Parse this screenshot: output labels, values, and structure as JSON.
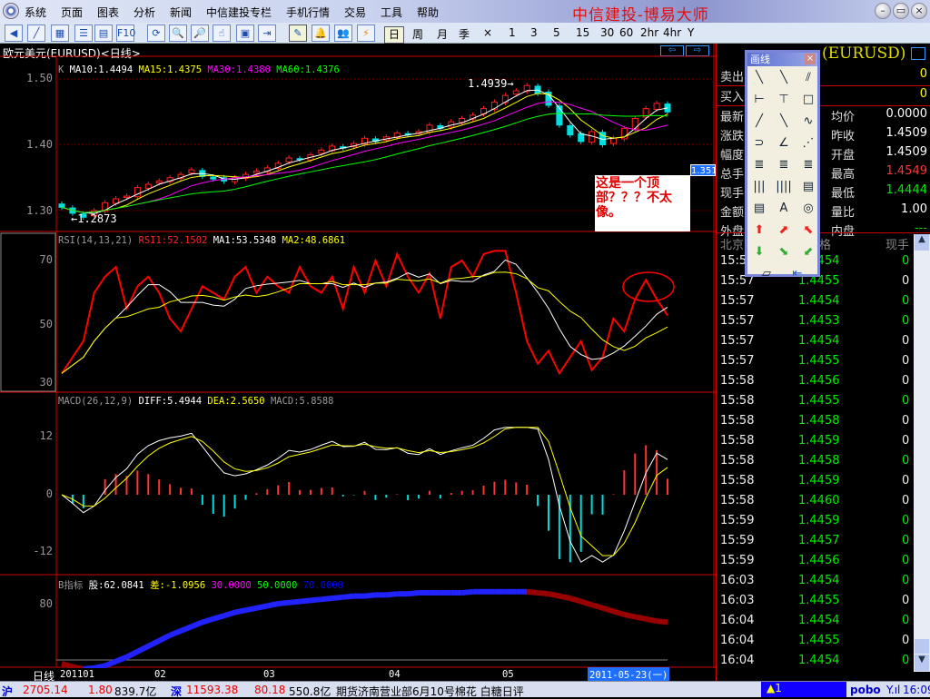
{
  "app": {
    "title": "中信建投-博易大师",
    "window_buttons": [
      "–",
      "▭",
      "×"
    ]
  },
  "menu": [
    "系统",
    "页面",
    "图表",
    "分析",
    "新闻",
    "中信建投专栏",
    "手机行情",
    "交易",
    "工具",
    "帮助"
  ],
  "toolbar": {
    "icons": [
      "back-icon",
      "line-chart-icon",
      "multi-chart-icon",
      "grid-icon",
      "report-icon",
      "f10-icon",
      "refresh-icon",
      "zoom-in-icon",
      "zoom-out-icon",
      "pointer-icon",
      "window-icon",
      "export-icon",
      "draw-icon",
      "alarm-icon",
      "users-icon",
      "flash-icon"
    ],
    "f10_label": "F10",
    "periods": [
      "日",
      "周",
      "月",
      "季",
      "×",
      "1",
      "3",
      "5",
      "15",
      "30",
      "60",
      "2hr",
      "4hr",
      "Y"
    ],
    "active_period": "日"
  },
  "chart": {
    "title": "欧元美元(EURUSD)<日线>",
    "main_header": {
      "k": "K",
      "ma10": "MA10:1.4494",
      "ma15": "MA15:1.4375",
      "ma30": "MA30:1.4380",
      "ma60": "MA60:1.4376"
    },
    "price_ticks": [
      "1.50",
      "1.40",
      "1.30"
    ],
    "high_label": "1.4939→",
    "low_label": "←1.2873",
    "cursor_price": "1.3510",
    "annotation": "这是一个顶部？？？不太像。",
    "rsi_header": {
      "name": "RSI(14,13,21)",
      "rsi1": "RSI1:52.1502",
      "ma1": "MA1:53.5348",
      "ma2": "MA2:48.6861"
    },
    "rsi_ticks": [
      "70",
      "50",
      "30"
    ],
    "macd_header": {
      "name": "MACD(26,12,9)",
      "diff": "DIFF:5.4944",
      "dea": "DEA:2.5650",
      "macd": "MACD:5.8588"
    },
    "macd_ticks": [
      "12",
      "0",
      "-12"
    ],
    "b_header": {
      "name": "B指标",
      "gu": "股:62.0841",
      "cha": "差:-1.0956",
      "l30": "30.0000",
      "l50": "50.0000",
      "l70": "70.0000"
    },
    "b_ticks": [
      "80"
    ],
    "period_label": "日线",
    "dates": [
      "201101",
      "02",
      "03",
      "04",
      "05"
    ],
    "cursor_date": "2011-05-23(一)"
  },
  "chart_data": {
    "type": "candlestick",
    "closes": [
      1.305,
      1.296,
      1.29,
      1.3,
      1.312,
      1.318,
      1.322,
      1.335,
      1.34,
      1.345,
      1.35,
      1.355,
      1.362,
      1.352,
      1.348,
      1.345,
      1.35,
      1.355,
      1.36,
      1.365,
      1.372,
      1.38,
      1.378,
      1.385,
      1.392,
      1.398,
      1.395,
      1.402,
      1.41,
      1.405,
      1.412,
      1.418,
      1.415,
      1.42,
      1.43,
      1.425,
      1.435,
      1.44,
      1.445,
      1.455,
      1.465,
      1.475,
      1.482,
      1.49,
      1.478,
      1.46,
      1.43,
      1.415,
      1.405,
      1.42,
      1.4,
      1.41,
      1.425,
      1.44,
      1.455,
      1.463,
      1.45
    ],
    "rsi": [
      35,
      40,
      45,
      60,
      65,
      68,
      55,
      62,
      65,
      60,
      52,
      48,
      55,
      62,
      60,
      58,
      65,
      68,
      60,
      65,
      62,
      60,
      68,
      62,
      60,
      65,
      55,
      68,
      60,
      70,
      62,
      72,
      65,
      60,
      66,
      52,
      68,
      70,
      65,
      72,
      73,
      73,
      60,
      45,
      38,
      42,
      35,
      40,
      45,
      36,
      40,
      52,
      48,
      58,
      64,
      58,
      53
    ],
    "b_values": [
      25,
      22,
      20,
      21,
      23,
      27,
      31,
      36,
      41,
      46,
      51,
      55,
      59,
      63,
      66,
      69,
      72,
      74,
      76,
      78,
      80,
      81,
      82,
      83,
      84,
      85,
      86,
      87,
      87,
      88,
      88,
      89,
      89,
      90,
      90,
      90,
      90,
      90,
      91,
      91,
      91,
      91,
      91,
      91,
      90,
      89,
      87,
      85,
      82,
      79,
      76,
      73,
      70,
      68,
      66,
      64,
      63
    ],
    "price_range": [
      1.28,
      1.51
    ],
    "rsi_range": [
      30,
      70
    ],
    "macd_range": [
      -12,
      12
    ]
  },
  "quote": {
    "symbol": "(EURUSD)",
    "rows": [
      {
        "label": "卖出",
        "value": "0"
      },
      {
        "label": "买入",
        "value": "0"
      }
    ],
    "left_labels": [
      "最新",
      "涨跌",
      "幅度",
      "总手",
      "现手",
      "金额",
      "外盘"
    ],
    "right": [
      {
        "label": "均价",
        "value": "0.0000"
      },
      {
        "label": "昨收",
        "value": "1.4509"
      },
      {
        "label": "开盘",
        "value": "1.4509"
      },
      {
        "label": "最高",
        "value": "1.4549"
      },
      {
        "label": "最低",
        "value": "1.4444"
      },
      {
        "label": "量比",
        "value": "1.00"
      },
      {
        "label": "内盘",
        "value": "---"
      }
    ],
    "tick_headers": [
      "北京",
      "价格",
      "现手"
    ],
    "ticks": [
      [
        "15:57",
        "1.4454",
        "0",
        "g"
      ],
      [
        "15:57",
        "1.4455",
        "0",
        "w"
      ],
      [
        "15:57",
        "1.4454",
        "0",
        "g"
      ],
      [
        "15:57",
        "1.4453",
        "0",
        "g"
      ],
      [
        "15:57",
        "1.4454",
        "0",
        "w"
      ],
      [
        "15:57",
        "1.4455",
        "0",
        "w"
      ],
      [
        "15:58",
        "1.4456",
        "0",
        "w"
      ],
      [
        "15:58",
        "1.4455",
        "0",
        "g"
      ],
      [
        "15:58",
        "1.4458",
        "0",
        "w"
      ],
      [
        "15:58",
        "1.4459",
        "0",
        "w"
      ],
      [
        "15:58",
        "1.4458",
        "0",
        "g"
      ],
      [
        "15:58",
        "1.4459",
        "0",
        "w"
      ],
      [
        "15:58",
        "1.4460",
        "0",
        "w"
      ],
      [
        "15:59",
        "1.4459",
        "0",
        "g"
      ],
      [
        "15:59",
        "1.4457",
        "0",
        "g"
      ],
      [
        "15:59",
        "1.4456",
        "0",
        "g"
      ],
      [
        "16:03",
        "1.4454",
        "0",
        "g"
      ],
      [
        "16:03",
        "1.4455",
        "0",
        "w"
      ],
      [
        "16:04",
        "1.4454",
        "0",
        "g"
      ],
      [
        "16:04",
        "1.4455",
        "0",
        "w"
      ],
      [
        "16:04",
        "1.4454",
        "0",
        "g"
      ]
    ]
  },
  "drawtool": {
    "title": "画线",
    "tools": [
      "line-icon",
      "segment-icon",
      "parallel-icon",
      "horizontal-line-icon",
      "vertical-line-icon",
      "rectangle-icon",
      "ray-up-icon",
      "ray-down-icon",
      "sine-icon",
      "arc-icon",
      "angle-icon",
      "fan-icon",
      "gann-icon",
      "fib-icon",
      "fib-ext-icon",
      "cycle-icon",
      "time-zone-icon",
      "channel-icon",
      "speed-icon",
      "text-icon",
      "gann-circle-icon",
      "up-arrow-icon",
      "up-right-arrow-icon",
      "up-left-arrow-icon",
      "down-arrow-icon",
      "down-right-arrow-icon",
      "down-left-arrow-icon",
      "eraser-icon",
      "delete-all-icon"
    ],
    "glyphs": [
      "╲",
      "╲",
      "⫽",
      "⊢",
      "⊤",
      "□",
      "╱",
      "╲",
      "∿",
      "⊃",
      "∠",
      "⋰",
      "≣",
      "≣",
      "≣",
      "|||",
      "||||",
      "▤",
      "▤",
      "A",
      "◎",
      "⬆",
      "⬈",
      "⬉",
      "⬇",
      "⬊",
      "⬋",
      "▱",
      "⇤"
    ]
  },
  "status": {
    "sh_label": "沪",
    "sh_index": "2705.14",
    "sh_change": "1.80",
    "sh_amount": "839.7亿",
    "sz_label": "深",
    "sz_index": "11593.38",
    "sz_change": "80.18",
    "sz_amount": "550.8亿",
    "news": "期货济南营业部6月10号棉花  白糖日评",
    "alert": "▲1",
    "brand": "pobo",
    "signal": "Y.ıl",
    "time": "16:09"
  },
  "colors": {
    "up": "#ff2020",
    "down": "#00e0e0",
    "ma10": "#ffffff",
    "ma15": "#ffff00",
    "ma30": "#ff00ff",
    "ma60": "#00ff00"
  }
}
